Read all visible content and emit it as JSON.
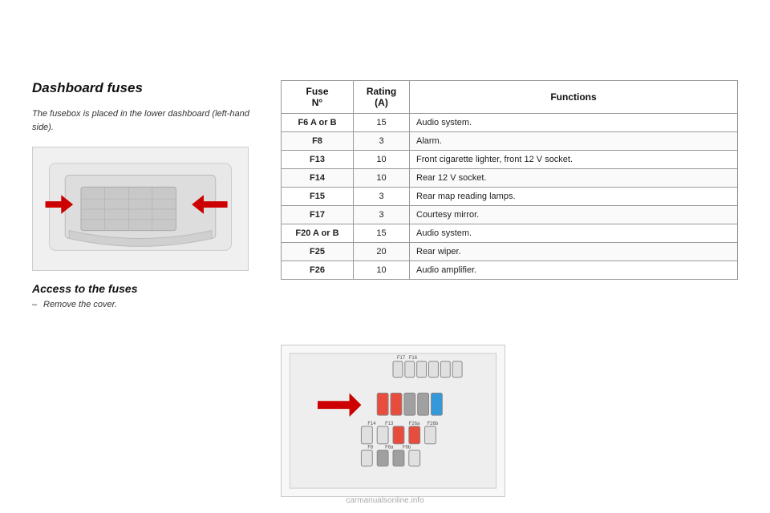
{
  "page": {
    "background": "#ffffff"
  },
  "left": {
    "title": "Dashboard fuses",
    "description": "The fusebox is placed in the lower dashboard (left-hand side).",
    "access_title": "Access to the fuses",
    "access_bullet": "Remove the cover."
  },
  "table": {
    "headers": {
      "fuse": "Fuse\nN°",
      "rating": "Rating\n(A)",
      "functions": "Functions"
    },
    "rows": [
      {
        "fuse": "F6 A or B",
        "rating": "15",
        "function": "Audio system."
      },
      {
        "fuse": "F8",
        "rating": "3",
        "function": "Alarm."
      },
      {
        "fuse": "F13",
        "rating": "10",
        "function": "Front cigarette lighter, front 12 V socket."
      },
      {
        "fuse": "F14",
        "rating": "10",
        "function": "Rear 12 V socket."
      },
      {
        "fuse": "F15",
        "rating": "3",
        "function": "Rear map reading lamps."
      },
      {
        "fuse": "F17",
        "rating": "3",
        "function": "Courtesy mirror."
      },
      {
        "fuse": "F20 A or B",
        "rating": "15",
        "function": "Audio system."
      },
      {
        "fuse": "F25",
        "rating": "20",
        "function": "Rear wiper."
      },
      {
        "fuse": "F26",
        "rating": "10",
        "function": "Audio amplifier."
      }
    ]
  },
  "watermark": "carmanualsonline.info"
}
